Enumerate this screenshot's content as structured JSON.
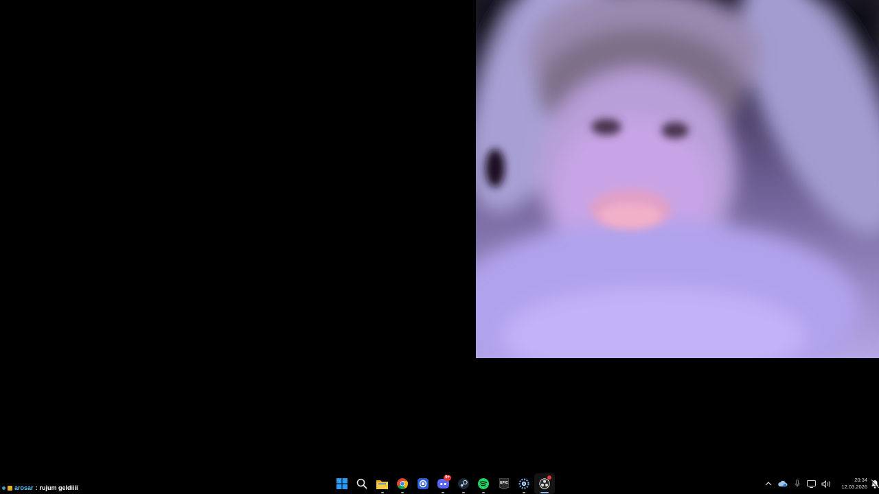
{
  "chat": {
    "username": "arosar",
    "separator": ":",
    "message": "rujum geldiiii"
  },
  "taskbar": {
    "apps": [
      {
        "name": "start-button",
        "icon": "windows-icon"
      },
      {
        "name": "search-button",
        "icon": "search-icon"
      },
      {
        "name": "file-explorer",
        "icon": "folder-icon"
      },
      {
        "name": "chrome",
        "icon": "chrome-icon"
      },
      {
        "name": "app-blue",
        "icon": "blue-app-icon"
      },
      {
        "name": "discord",
        "icon": "discord-icon",
        "badge": "9+"
      },
      {
        "name": "steam",
        "icon": "steam-icon"
      },
      {
        "name": "spotify",
        "icon": "spotify-icon"
      },
      {
        "name": "epic-games",
        "icon": "epic-games-icon",
        "label": "EPIC"
      },
      {
        "name": "app-gear",
        "icon": "gear-app-icon"
      },
      {
        "name": "obs",
        "icon": "obs-icon"
      }
    ],
    "discord_badge": "9+",
    "epic_label": "EPIC",
    "clock": {
      "time": "20:34",
      "date": "12.03.2026"
    }
  },
  "colors": {
    "accent": "#2b9bf4",
    "background": "#000000",
    "chat_user": "#5ec8ff"
  }
}
